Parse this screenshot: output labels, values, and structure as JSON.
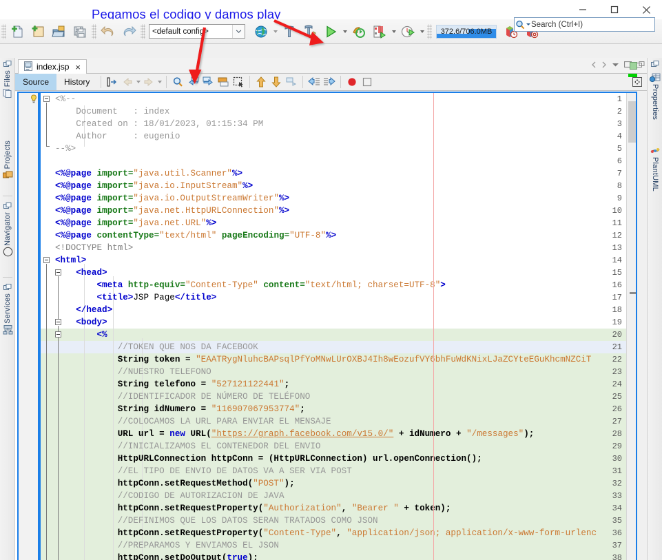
{
  "window": {
    "title": "",
    "controls": {
      "minimize": "minimize-icon",
      "maximize": "maximize-icon",
      "close": "close-icon"
    }
  },
  "annotation": {
    "text": "Pegamos el codigo y damos play",
    "color": "#1b19e8",
    "arrow_color": "#ee1c1c",
    "arrows": [
      {
        "name": "arrow-to-paste-button",
        "from": [
          295,
          42
        ],
        "to": [
          283,
          118
        ]
      },
      {
        "name": "arrow-to-run-button",
        "from": [
          400,
          32
        ],
        "to": [
          468,
          62
        ]
      }
    ]
  },
  "search": {
    "placeholder": "Search (Ctrl+I)",
    "icon": "search-icon"
  },
  "toolbar": {
    "groups": [
      {
        "name": "file-group",
        "buttons": [
          {
            "name": "new-file-button",
            "icon": "new-file-icon",
            "label": "New File"
          },
          {
            "name": "new-project-button",
            "icon": "new-project-icon",
            "label": "New Project"
          },
          {
            "name": "open-project-button",
            "icon": "open-project-icon",
            "label": "Open Project"
          },
          {
            "name": "save-all-button",
            "icon": "save-all-icon",
            "label": "Save All"
          }
        ]
      },
      {
        "name": "edit-group",
        "buttons": [
          {
            "name": "undo-button",
            "icon": "undo-icon",
            "label": "Undo"
          },
          {
            "name": "redo-button",
            "icon": "redo-icon",
            "label": "Redo"
          }
        ]
      }
    ],
    "config_combo": {
      "name": "project-configuration-combo",
      "value": "<default config>",
      "options": [
        "<default config>"
      ]
    },
    "run_group": [
      {
        "name": "browser-button",
        "icon": "globe-icon",
        "label": "Browser"
      },
      {
        "name": "build-project-button",
        "icon": "hammer-icon",
        "label": "Build Project"
      },
      {
        "name": "clean-and-build-button",
        "icon": "hammer-broom-icon",
        "label": "Clean and Build Project"
      },
      {
        "name": "run-project-button",
        "icon": "play-icon",
        "label": "Run Project"
      },
      {
        "name": "debug-project-button",
        "icon": "debug-icon",
        "label": "Debug Project"
      },
      {
        "name": "profile-project-button",
        "icon": "profile-icon",
        "label": "Profile Project"
      },
      {
        "name": "team-button",
        "icon": "clock-play-icon",
        "label": "Run Measure"
      }
    ],
    "memory": {
      "name": "memory-gauge",
      "text": "372.6/706.0MB",
      "used": "372.6",
      "total": "706.0",
      "unit": "MB",
      "percent": 52.8
    },
    "profiler_buttons": [
      {
        "name": "profile-history-button",
        "icon": "box-clock-icon"
      },
      {
        "name": "profile-stop-button",
        "icon": "box-stop-icon"
      }
    ]
  },
  "left_dock": {
    "items": [
      {
        "name": "sidebar-item-files",
        "label": "Files",
        "icon": "files-icon"
      },
      {
        "name": "sidebar-item-projects",
        "label": "Projects",
        "icon": "projects-icon"
      },
      {
        "name": "sidebar-item-navigator",
        "label": "Navigator",
        "icon": "navigator-compass-icon"
      },
      {
        "name": "sidebar-item-services",
        "label": "Services",
        "icon": "services-icon"
      }
    ]
  },
  "right_dock": {
    "items": [
      {
        "name": "sidebar-item-properties",
        "label": "Properties",
        "icon": "properties-icon"
      },
      {
        "name": "sidebar-item-plantuml",
        "label": "PlantUML",
        "icon": "plantuml-icon"
      }
    ]
  },
  "editor": {
    "tab": {
      "name": "file-tab-index-jsp",
      "label": "index.jsp",
      "icon": "jsp-file-icon",
      "close": "×"
    },
    "tab_controls": [
      "scroll-left",
      "scroll-right",
      "tab-list-dropdown",
      "maximize-window",
      "float-window"
    ],
    "view_tabs": [
      {
        "name": "tab-source",
        "label": "Source",
        "active": true
      },
      {
        "name": "tab-history",
        "label": "History",
        "active": false
      }
    ],
    "toolbar_buttons": [
      {
        "name": "toggle-bookmark-button",
        "icon": "bookmark-toggle-icon"
      },
      {
        "name": "previous-bookmark-button",
        "icon": "arrow-back-icon",
        "disabled": true
      },
      {
        "name": "next-bookmark-button",
        "icon": "arrow-forward-icon",
        "disabled": true
      },
      {
        "name": "find-selection-button",
        "icon": "magnifier-icon"
      },
      {
        "name": "previous-occurrence-button",
        "icon": "prev-match-icon"
      },
      {
        "name": "next-occurrence-button",
        "icon": "next-match-icon"
      },
      {
        "name": "toggle-highlight-button",
        "icon": "highlight-icon"
      },
      {
        "name": "toggle-rectangular-selection-button",
        "icon": "rect-select-icon"
      },
      {
        "name": "previous-error-button",
        "icon": "up-arrow-icon"
      },
      {
        "name": "next-error-button",
        "icon": "down-arrow-icon"
      },
      {
        "name": "last-edit-button",
        "icon": "last-edit-icon"
      },
      {
        "name": "shift-left-button",
        "icon": "shift-left-icon"
      },
      {
        "name": "shift-right-button",
        "icon": "shift-right-icon"
      },
      {
        "name": "start-macro-recording-button",
        "icon": "record-icon"
      },
      {
        "name": "stop-macro-recording-button",
        "icon": "stop-icon"
      }
    ],
    "right_toolbar_button": {
      "name": "toggle-toolbar-button",
      "icon": "expand-grid-icon"
    },
    "first_line_hint_icon": "lightbulb-hint-icon",
    "margin_column": 80,
    "scrollbar": {
      "name": "vertical-scrollbar",
      "thumb_top_pct": 2,
      "thumb_height_pct": 9
    },
    "error_stripe": {
      "status": "ok",
      "status_color": "#9ed39b",
      "marker_color": "#00d200"
    }
  },
  "code": {
    "lines": [
      {
        "n": 1,
        "bg": "none",
        "tokens": [
          {
            "t": "<%--",
            "c": "c-cmt"
          }
        ]
      },
      {
        "n": 2,
        "bg": "none",
        "tokens": [
          {
            "t": "    Document   : index",
            "c": "c-cmt"
          }
        ]
      },
      {
        "n": 3,
        "bg": "none",
        "tokens": [
          {
            "t": "    Created on : 18/01/2023, 01:15:34 PM",
            "c": "c-cmt"
          }
        ]
      },
      {
        "n": 4,
        "bg": "none",
        "tokens": [
          {
            "t": "    Author     : eugenio",
            "c": "c-cmt"
          }
        ]
      },
      {
        "n": 5,
        "bg": "none",
        "tokens": [
          {
            "t": "--%>",
            "c": "c-cmt"
          }
        ]
      },
      {
        "n": 6,
        "bg": "none",
        "tokens": []
      },
      {
        "n": 7,
        "bg": "none",
        "tokens": [
          {
            "t": "<%@page ",
            "c": "c-tagb"
          },
          {
            "t": "import=",
            "c": "c-attrb"
          },
          {
            "t": "\"java.util.Scanner\"",
            "c": "c-str"
          },
          {
            "t": "%>",
            "c": "c-tagb"
          }
        ]
      },
      {
        "n": 8,
        "bg": "none",
        "tokens": [
          {
            "t": "<%@page ",
            "c": "c-tagb"
          },
          {
            "t": "import=",
            "c": "c-attrb"
          },
          {
            "t": "\"java.io.InputStream\"",
            "c": "c-str"
          },
          {
            "t": "%>",
            "c": "c-tagb"
          }
        ]
      },
      {
        "n": 9,
        "bg": "none",
        "tokens": [
          {
            "t": "<%@page ",
            "c": "c-tagb"
          },
          {
            "t": "import=",
            "c": "c-attrb"
          },
          {
            "t": "\"java.io.OutputStreamWriter\"",
            "c": "c-str"
          },
          {
            "t": "%>",
            "c": "c-tagb"
          }
        ]
      },
      {
        "n": 10,
        "bg": "none",
        "tokens": [
          {
            "t": "<%@page ",
            "c": "c-tagb"
          },
          {
            "t": "import=",
            "c": "c-attrb"
          },
          {
            "t": "\"java.net.HttpURLConnection\"",
            "c": "c-str"
          },
          {
            "t": "%>",
            "c": "c-tagb"
          }
        ]
      },
      {
        "n": 11,
        "bg": "none",
        "tokens": [
          {
            "t": "<%@page ",
            "c": "c-tagb"
          },
          {
            "t": "import=",
            "c": "c-attrb"
          },
          {
            "t": "\"java.net.URL\"",
            "c": "c-str"
          },
          {
            "t": "%>",
            "c": "c-tagb"
          }
        ]
      },
      {
        "n": 12,
        "bg": "none",
        "tokens": [
          {
            "t": "<%@page ",
            "c": "c-tagb"
          },
          {
            "t": "contentType=",
            "c": "c-attrb"
          },
          {
            "t": "\"text/html\"",
            "c": "c-str"
          },
          {
            "t": " ",
            "c": "c-txt"
          },
          {
            "t": "pageEncoding=",
            "c": "c-attrb"
          },
          {
            "t": "\"UTF-8\"",
            "c": "c-str"
          },
          {
            "t": "%>",
            "c": "c-tagb"
          }
        ]
      },
      {
        "n": 13,
        "bg": "none",
        "tokens": [
          {
            "t": "<!DOCTYPE html>",
            "c": "c-doct"
          }
        ]
      },
      {
        "n": 14,
        "bg": "none",
        "tokens": [
          {
            "t": "<html>",
            "c": "c-tagb"
          }
        ]
      },
      {
        "n": 15,
        "bg": "none",
        "tokens": [
          {
            "t": "    <head>",
            "c": "c-tagb"
          }
        ]
      },
      {
        "n": 16,
        "bg": "none",
        "tokens": [
          {
            "t": "        <meta ",
            "c": "c-tagb"
          },
          {
            "t": "http-equiv=",
            "c": "c-attrb"
          },
          {
            "t": "\"Content-Type\"",
            "c": "c-str"
          },
          {
            "t": " ",
            "c": "c-txt"
          },
          {
            "t": "content=",
            "c": "c-attrb"
          },
          {
            "t": "\"text/html; charset=UTF-8\"",
            "c": "c-str"
          },
          {
            "t": ">",
            "c": "c-tagb"
          }
        ]
      },
      {
        "n": 17,
        "bg": "none",
        "tokens": [
          {
            "t": "        <title>",
            "c": "c-tagb"
          },
          {
            "t": "JSP Page",
            "c": "c-txt"
          },
          {
            "t": "</title>",
            "c": "c-tagb"
          }
        ]
      },
      {
        "n": 18,
        "bg": "none",
        "tokens": [
          {
            "t": "    </head>",
            "c": "c-tagb"
          }
        ]
      },
      {
        "n": 19,
        "bg": "none",
        "tokens": [
          {
            "t": "    <body>",
            "c": "c-tagb"
          }
        ]
      },
      {
        "n": 20,
        "bg": "green",
        "tokens": [
          {
            "t": "        <%",
            "c": "c-tagb"
          }
        ]
      },
      {
        "n": 21,
        "bg": "blue",
        "tokens": [
          {
            "t": "            //TOKEN QUE NOS DA FACEBOOK",
            "c": "c-cmt"
          }
        ]
      },
      {
        "n": 22,
        "bg": "green",
        "tokens": [
          {
            "t": "            String token",
            "c": "c-txtb"
          },
          {
            "t": " = ",
            "c": "c-txtb"
          },
          {
            "t": "\"EAATRygNluhcBAPsqlPfYoMNwLUrOXBJ4Ih8wEozufVY6bhFuWdKNixLJaZCYteEGuKhcmNZCiT",
            "c": "c-str"
          }
        ]
      },
      {
        "n": 23,
        "bg": "green",
        "tokens": [
          {
            "t": "            //NUESTRO TELEFONO",
            "c": "c-cmt"
          }
        ]
      },
      {
        "n": 24,
        "bg": "green",
        "tokens": [
          {
            "t": "            String telefono",
            "c": "c-txtb"
          },
          {
            "t": " = ",
            "c": "c-txtb"
          },
          {
            "t": "\"527121122441\"",
            "c": "c-str"
          },
          {
            "t": ";",
            "c": "c-txtb"
          }
        ]
      },
      {
        "n": 25,
        "bg": "green",
        "tokens": [
          {
            "t": "            //IDENTIFICADOR DE NÚMERO DE TELÉFONO",
            "c": "c-cmt"
          }
        ]
      },
      {
        "n": 26,
        "bg": "green",
        "tokens": [
          {
            "t": "            String idNumero",
            "c": "c-txtb"
          },
          {
            "t": " = ",
            "c": "c-txtb"
          },
          {
            "t": "\"116907067953774\"",
            "c": "c-str"
          },
          {
            "t": ";",
            "c": "c-txtb"
          }
        ]
      },
      {
        "n": 27,
        "bg": "green",
        "tokens": [
          {
            "t": "            //COLOCAMOS LA URL PARA ENVIAR EL MENSAJE",
            "c": "c-cmt"
          }
        ]
      },
      {
        "n": 28,
        "bg": "green",
        "tokens": [
          {
            "t": "            URL url",
            "c": "c-txtb"
          },
          {
            "t": " = ",
            "c": "c-txtb"
          },
          {
            "t": "new",
            "c": "c-kw"
          },
          {
            "t": " URL(",
            "c": "c-txtb"
          },
          {
            "t": "\"https://graph.facebook.com/v15.0/\"",
            "c": "c-link"
          },
          {
            "t": " + idNumero + ",
            "c": "c-txtb"
          },
          {
            "t": "\"/messages\"",
            "c": "c-str"
          },
          {
            "t": ");",
            "c": "c-txtb"
          }
        ]
      },
      {
        "n": 29,
        "bg": "green",
        "tokens": [
          {
            "t": "            //INICIALIZAMOS EL CONTENEDOR DEL ENVIO",
            "c": "c-cmt"
          }
        ]
      },
      {
        "n": 30,
        "bg": "green",
        "tokens": [
          {
            "t": "            HttpURLConnection httpConn",
            "c": "c-txtb"
          },
          {
            "t": " = (HttpURLConnection) url.openConnection();",
            "c": "c-txtb"
          }
        ]
      },
      {
        "n": 31,
        "bg": "green",
        "tokens": [
          {
            "t": "            //EL TIPO DE ENVIO DE DATOS VA A SER VIA POST",
            "c": "c-cmt"
          }
        ]
      },
      {
        "n": 32,
        "bg": "green",
        "tokens": [
          {
            "t": "            httpConn.setRequestMethod(",
            "c": "c-txtb"
          },
          {
            "t": "\"POST\"",
            "c": "c-str"
          },
          {
            "t": ");",
            "c": "c-txtb"
          }
        ]
      },
      {
        "n": 33,
        "bg": "green",
        "tokens": [
          {
            "t": "            //CODIGO DE AUTORIZACION DE JAVA",
            "c": "c-cmt"
          }
        ]
      },
      {
        "n": 34,
        "bg": "green",
        "tokens": [
          {
            "t": "            httpConn.setRequestProperty(",
            "c": "c-txtb"
          },
          {
            "t": "\"Authorization\"",
            "c": "c-str"
          },
          {
            "t": ", ",
            "c": "c-txtb"
          },
          {
            "t": "\"Bearer \"",
            "c": "c-str"
          },
          {
            "t": " + token);",
            "c": "c-txtb"
          }
        ]
      },
      {
        "n": 35,
        "bg": "green",
        "tokens": [
          {
            "t": "            //DEFINIMOS QUE LOS DATOS SERAN TRATADOS COMO JSON",
            "c": "c-cmt"
          }
        ]
      },
      {
        "n": 36,
        "bg": "green",
        "tokens": [
          {
            "t": "            httpConn.setRequestProperty(",
            "c": "c-txtb"
          },
          {
            "t": "\"Content-Type\"",
            "c": "c-str"
          },
          {
            "t": ", ",
            "c": "c-txtb"
          },
          {
            "t": "\"application/json; application/x-www-form-urlenc",
            "c": "c-str"
          }
        ]
      },
      {
        "n": 37,
        "bg": "green",
        "tokens": [
          {
            "t": "            //PREPARAMOS Y ENVIAMOS EL JSON",
            "c": "c-cmt"
          }
        ]
      },
      {
        "n": 38,
        "bg": "green",
        "tokens": [
          {
            "t": "            httpConn.setDoOutput(",
            "c": "c-txtb"
          },
          {
            "t": "true",
            "c": "c-kw"
          },
          {
            "t": ");",
            "c": "c-txtb"
          }
        ]
      }
    ]
  }
}
